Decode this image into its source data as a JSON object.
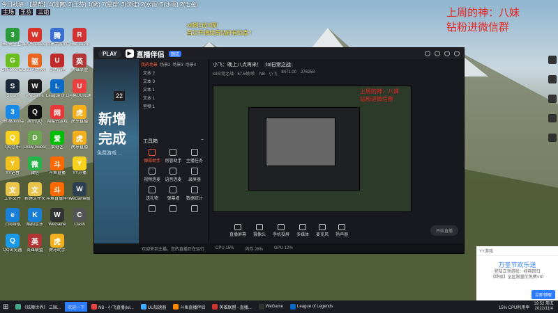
{
  "overlay": {
    "line1": "今日战绩：【星帮】4(逃离) 2(王芬) 1(鹰) 7(星帮) 3(法硅) 2(水雨) 5(水雨) 2(七金)",
    "tags": [
      "主场",
      "王芬",
      "三组"
    ]
  },
  "notice": {
    "line1": "x8刷1份X周!",
    "line2": "首次开通续费钻粉有惊喜 !"
  },
  "promo": {
    "line1": "上周的神：八妹",
    "line2": "钻粉进微信群"
  },
  "desktop_icons": [
    {
      "label": "360安全卫士",
      "color": "#2b9a3a",
      "glyph": "3"
    },
    {
      "label": "WPS Office",
      "color": "#d9342b",
      "glyph": "W"
    },
    {
      "label": "腾讯手游助手",
      "color": "#3a6fd1",
      "glyph": "腾"
    },
    {
      "label": "Riot Client",
      "color": "#d13232",
      "glyph": "R"
    },
    {
      "label": "GeForce Experience",
      "color": "#6abf1f",
      "glyph": "G"
    },
    {
      "label": "360驱动大师",
      "color": "#e8641f",
      "glyph": "驱"
    },
    {
      "label": "U盘管理",
      "color": "#c12a2a",
      "glyph": "U"
    },
    {
      "label": "英雄联盟",
      "color": "#b23636",
      "glyph": "英"
    },
    {
      "label": "Steam",
      "color": "#1b2838",
      "glyph": "S"
    },
    {
      "label": "WeGame",
      "color": "#1a1a1a",
      "glyph": "W"
    },
    {
      "label": "League of Legends",
      "color": "#0a6ac6",
      "glyph": "L"
    },
    {
      "label": "网易UU加速器",
      "color": "#ea4040",
      "glyph": "U"
    },
    {
      "label": "360桌面助手",
      "color": "#1a8ae6",
      "glyph": "3"
    },
    {
      "label": "腾讯QQ",
      "color": "#111",
      "glyph": "Q"
    },
    {
      "label": "网易云游戏",
      "color": "#e83838",
      "glyph": "网"
    },
    {
      "label": "虎牙直播",
      "color": "#f2b01e",
      "glyph": "虎"
    },
    {
      "label": "QQ音乐",
      "color": "#f7d21e",
      "glyph": "Q"
    },
    {
      "label": "Draw Guess",
      "color": "#6aa84f",
      "glyph": "D"
    },
    {
      "label": "爱奇艺",
      "color": "#00be06",
      "glyph": "爱"
    },
    {
      "label": "虎牙直播",
      "color": "#f2b01e",
      "glyph": "虎"
    },
    {
      "label": "YY语音",
      "color": "#f2c21e",
      "glyph": "Y"
    },
    {
      "label": "微信",
      "color": "#27b34a",
      "glyph": "微"
    },
    {
      "label": "斗鱼直播",
      "color": "#ff6a00",
      "glyph": "斗"
    },
    {
      "label": "YY开播",
      "color": "#f7d21e",
      "glyph": "Y"
    },
    {
      "label": "工作文件",
      "color": "#e9c44b",
      "glyph": "文"
    },
    {
      "label": "新建文件夹",
      "color": "#e9c44b",
      "glyph": "文"
    },
    {
      "label": "斗鱼直播伴侣",
      "color": "#ff6a00",
      "glyph": "斗"
    },
    {
      "label": "WeGame版",
      "color": "#2c3e50",
      "glyph": "W"
    },
    {
      "label": "上网导航",
      "color": "#1a7fd6",
      "glyph": "e"
    },
    {
      "label": "酷狗音乐",
      "color": "#1a7fd6",
      "glyph": "K"
    },
    {
      "label": "WeGame",
      "color": "#333",
      "glyph": "W"
    },
    {
      "label": "Clash",
      "color": "#555",
      "glyph": "C"
    },
    {
      "label": "QQ浏览器",
      "color": "#1a9ae6",
      "glyph": "Q"
    },
    {
      "label": "英雄联盟",
      "color": "#b23636",
      "glyph": "英"
    },
    {
      "label": "虎牙助手",
      "color": "#f2b01e",
      "glyph": "虎"
    }
  ],
  "app": {
    "play_label": "PLAY",
    "name": "直播伴侣",
    "badge": "测试",
    "tabs": [
      "我的场景",
      "场景2",
      "场景3",
      "场景4"
    ],
    "scenes": [
      "文本 2",
      "文本 3",
      "文本 1",
      "文本 1",
      "音频 1"
    ],
    "tools_header": "工具箱",
    "tools": [
      "弹幕助手",
      "房管助手",
      "主播任务",
      "视频连麦",
      "语音连麦",
      "录屏器",
      "送礼物",
      "弹幕墙",
      "数据统计",
      "",
      "",
      ""
    ],
    "title_text": "小飞：晚上八点再来！",
    "sub_text": "lol日常之战",
    "stats": [
      "lol日常之战 · 67.5帧/秒",
      "NB · 小飞",
      "8471.00",
      "276258"
    ],
    "preview_text_1": "上周的神：八妹",
    "preview_text_2": "钻粉进微信群",
    "bottom_buttons": [
      "直播屏幕",
      "摄像头",
      "手机投屏",
      "多媒体",
      "麦克风",
      "扬声器"
    ],
    "start_label": "开始直播",
    "status_items": [
      "欢迎来到主播，您的直播正在运行",
      "CPU 15%",
      "内存 28%",
      "GPU 12%"
    ],
    "live_badge_1": "BE",
    "banner_num": "22",
    "banner_line1": "新增",
    "banner_line2": "完成",
    "banner_sub": "免费游戏 ..."
  },
  "popup": {
    "header": "YY游戏",
    "title": "万圣节欢乐送",
    "desc1": "登陆立领游戏：经典回归",
    "desc2": "【终极】全区限量优免费VIP",
    "button": "立即领取"
  },
  "taskbar": {
    "items": [
      "《炫舞世界》 三国...",
      "欢迎一下",
      "NB - 小飞直播(lol...",
      "UU加速器",
      "斗鱼直播伴侣",
      "英雄联盟 - 直播...",
      "WeGame",
      "League of Legends"
    ],
    "cpu_label": "15% CPU利用率",
    "time": "19:52 周五",
    "date": "2022/11/4"
  }
}
